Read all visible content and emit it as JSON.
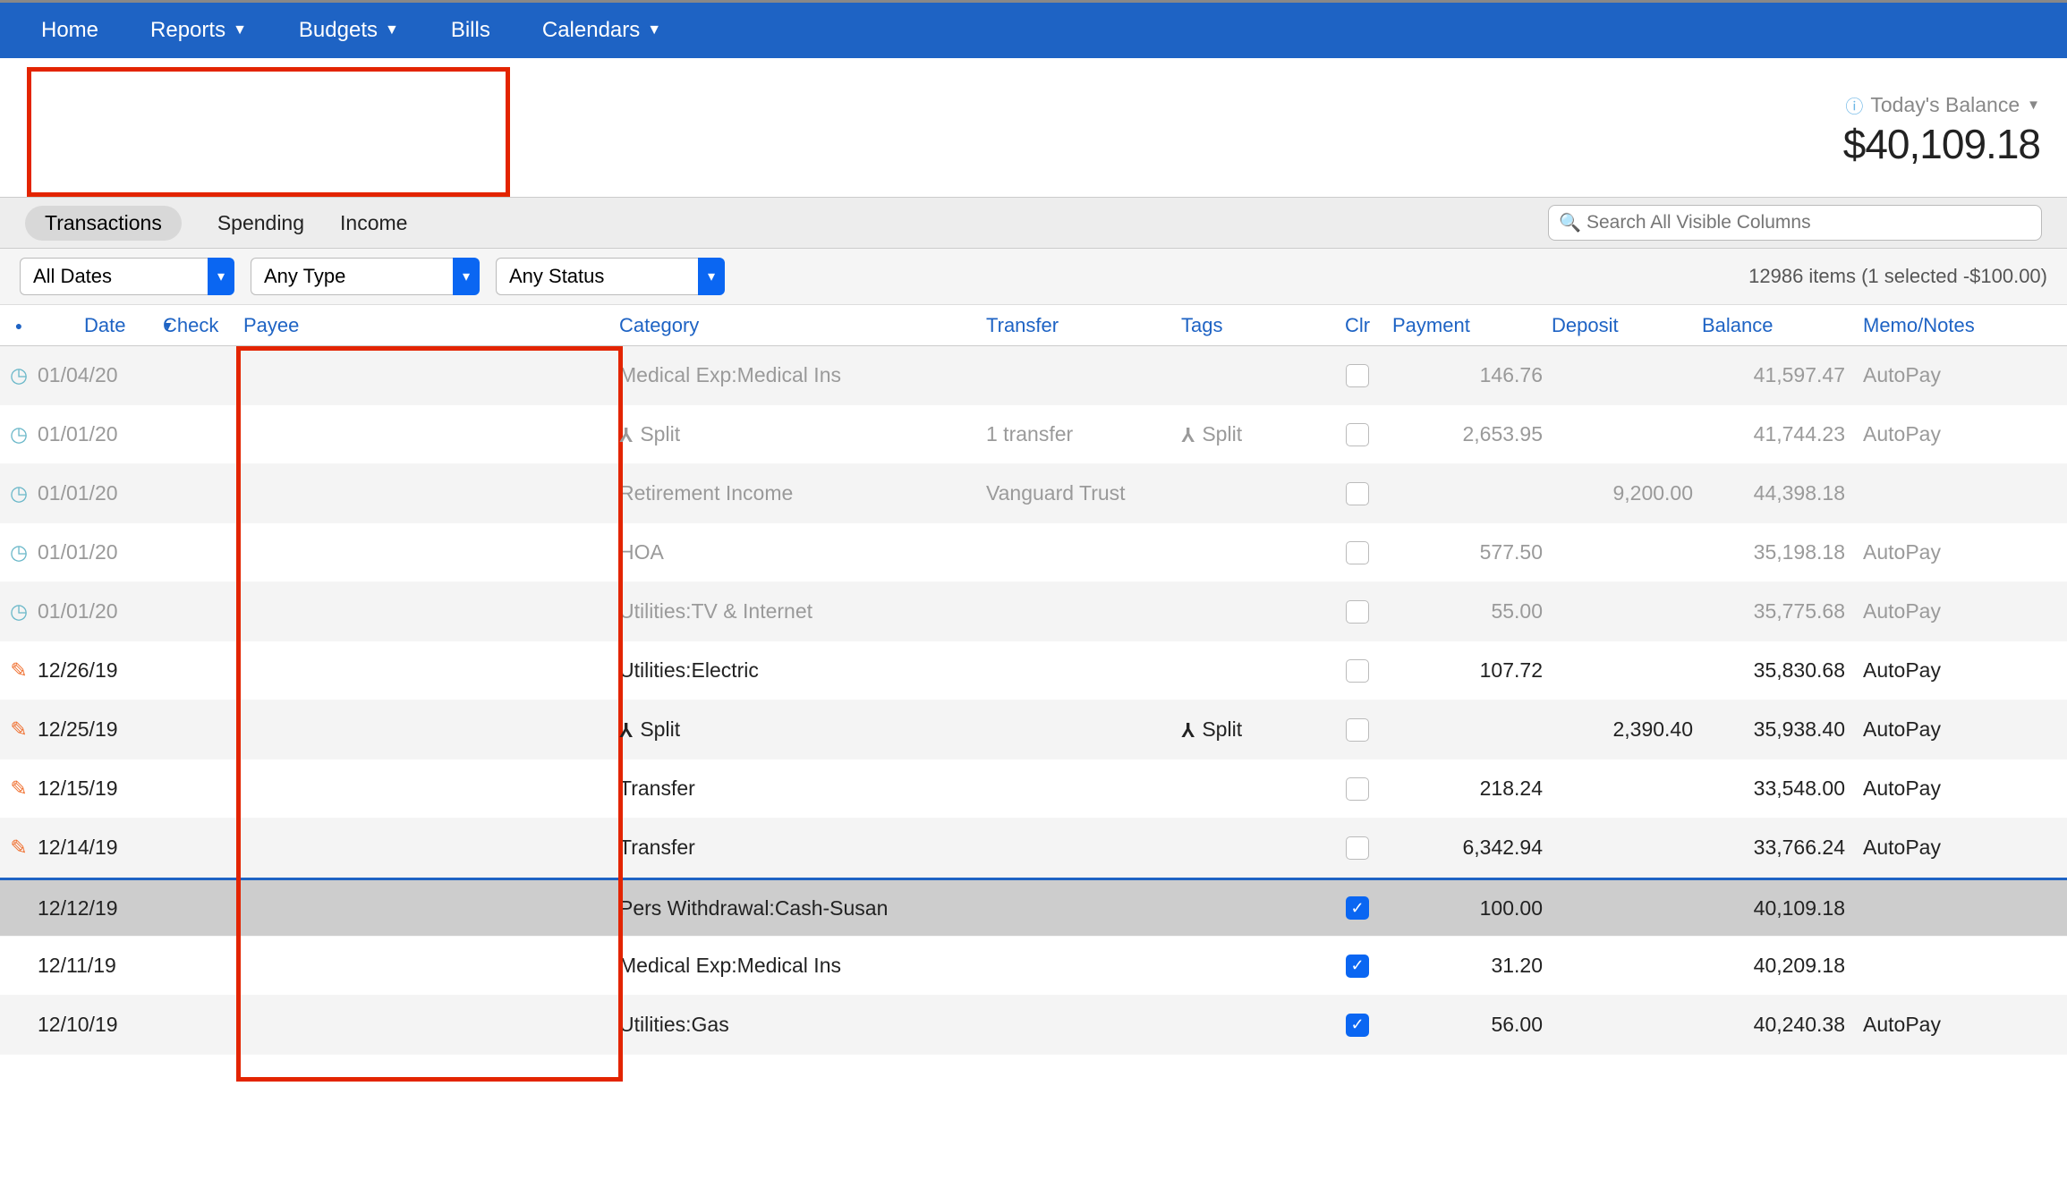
{
  "nav": {
    "home": "Home",
    "reports": "Reports",
    "budgets": "Budgets",
    "bills": "Bills",
    "calendars": "Calendars"
  },
  "balance": {
    "label": "Today's Balance",
    "amount": "$40,109.18"
  },
  "tabs": {
    "transactions": "Transactions",
    "spending": "Spending",
    "income": "Income"
  },
  "search": {
    "placeholder": "Search All Visible Columns"
  },
  "filters": {
    "dates": "All Dates",
    "type": "Any Type",
    "status": "Any Status",
    "items_status": "12986 items (1 selected -$100.00)"
  },
  "columns": {
    "date": "Date",
    "check": "Check",
    "payee": "Payee",
    "category": "Category",
    "transfer": "Transfer",
    "tags": "Tags",
    "clr": "Clr",
    "payment": "Payment",
    "deposit": "Deposit",
    "balance": "Balance",
    "memo": "Memo/Notes"
  },
  "split_label": "Split",
  "rows": [
    {
      "icon": "clock",
      "date": "01/04/20",
      "payee": "",
      "cat": "Medical Exp:Medical Ins",
      "cat_split": false,
      "transfer": "",
      "tags": "",
      "tags_split": false,
      "clr": false,
      "pay": "146.76",
      "dep": "",
      "bal": "41,597.47",
      "memo": "AutoPay",
      "sched": true,
      "sel": false,
      "alt": true
    },
    {
      "icon": "clock",
      "date": "01/01/20",
      "payee": "",
      "cat": "Split",
      "cat_split": true,
      "transfer": "1 transfer",
      "tags": "Split",
      "tags_split": true,
      "clr": false,
      "pay": "2,653.95",
      "dep": "",
      "bal": "41,744.23",
      "memo": "AutoPay",
      "sched": true,
      "sel": false,
      "alt": false
    },
    {
      "icon": "clock",
      "date": "01/01/20",
      "payee": "",
      "cat": "Retirement Income",
      "cat_split": false,
      "transfer": "Vanguard Trust",
      "tags": "",
      "tags_split": false,
      "clr": false,
      "pay": "",
      "dep": "9,200.00",
      "bal": "44,398.18",
      "memo": "",
      "sched": true,
      "sel": false,
      "alt": true
    },
    {
      "icon": "clock",
      "date": "01/01/20",
      "payee": "",
      "cat": "HOA",
      "cat_split": false,
      "transfer": "",
      "tags": "",
      "tags_split": false,
      "clr": false,
      "pay": "577.50",
      "dep": "",
      "bal": "35,198.18",
      "memo": "AutoPay",
      "sched": true,
      "sel": false,
      "alt": false
    },
    {
      "icon": "clock",
      "date": "01/01/20",
      "payee": "",
      "cat": "Utilities:TV & Internet",
      "cat_split": false,
      "transfer": "",
      "tags": "",
      "tags_split": false,
      "clr": false,
      "pay": "55.00",
      "dep": "",
      "bal": "35,775.68",
      "memo": "AutoPay",
      "sched": true,
      "sel": false,
      "alt": true
    },
    {
      "icon": "pencil",
      "date": "12/26/19",
      "payee": "",
      "cat": "Utilities:Electric",
      "cat_split": false,
      "transfer": "",
      "tags": "",
      "tags_split": false,
      "clr": false,
      "pay": "107.72",
      "dep": "",
      "bal": "35,830.68",
      "memo": "AutoPay",
      "sched": false,
      "sel": false,
      "alt": false
    },
    {
      "icon": "pencil",
      "date": "12/25/19",
      "payee": "",
      "cat": "Split",
      "cat_split": true,
      "transfer": "",
      "tags": "Split",
      "tags_split": true,
      "clr": false,
      "pay": "",
      "dep": "2,390.40",
      "bal": "35,938.40",
      "memo": "AutoPay",
      "sched": false,
      "sel": false,
      "alt": true
    },
    {
      "icon": "pencil",
      "date": "12/15/19",
      "payee": "",
      "cat": "Transfer",
      "cat_split": false,
      "transfer": "",
      "tags": "",
      "tags_split": false,
      "clr": false,
      "pay": "218.24",
      "dep": "",
      "bal": "33,548.00",
      "memo": "AutoPay",
      "sched": false,
      "sel": false,
      "alt": false
    },
    {
      "icon": "pencil",
      "date": "12/14/19",
      "payee": "",
      "cat": "Transfer",
      "cat_split": false,
      "transfer": "",
      "tags": "",
      "tags_split": false,
      "clr": false,
      "pay": "6,342.94",
      "dep": "",
      "bal": "33,766.24",
      "memo": "AutoPay",
      "sched": false,
      "sel": false,
      "alt": true
    },
    {
      "icon": "",
      "date": "12/12/19",
      "payee": "",
      "cat": "Pers Withdrawal:Cash-Susan",
      "cat_split": false,
      "transfer": "",
      "tags": "",
      "tags_split": false,
      "clr": true,
      "pay": "100.00",
      "dep": "",
      "bal": "40,109.18",
      "memo": "",
      "sched": false,
      "sel": true,
      "alt": false
    },
    {
      "icon": "",
      "date": "12/11/19",
      "payee": "",
      "cat": "Medical Exp:Medical Ins",
      "cat_split": false,
      "transfer": "",
      "tags": "",
      "tags_split": false,
      "clr": true,
      "pay": "31.20",
      "dep": "",
      "bal": "40,209.18",
      "memo": "",
      "sched": false,
      "sel": false,
      "alt": false
    },
    {
      "icon": "",
      "date": "12/10/19",
      "payee": "",
      "cat": "Utilities:Gas",
      "cat_split": false,
      "transfer": "",
      "tags": "",
      "tags_split": false,
      "clr": true,
      "pay": "56.00",
      "dep": "",
      "bal": "40,240.38",
      "memo": "AutoPay",
      "sched": false,
      "sel": false,
      "alt": true
    }
  ]
}
